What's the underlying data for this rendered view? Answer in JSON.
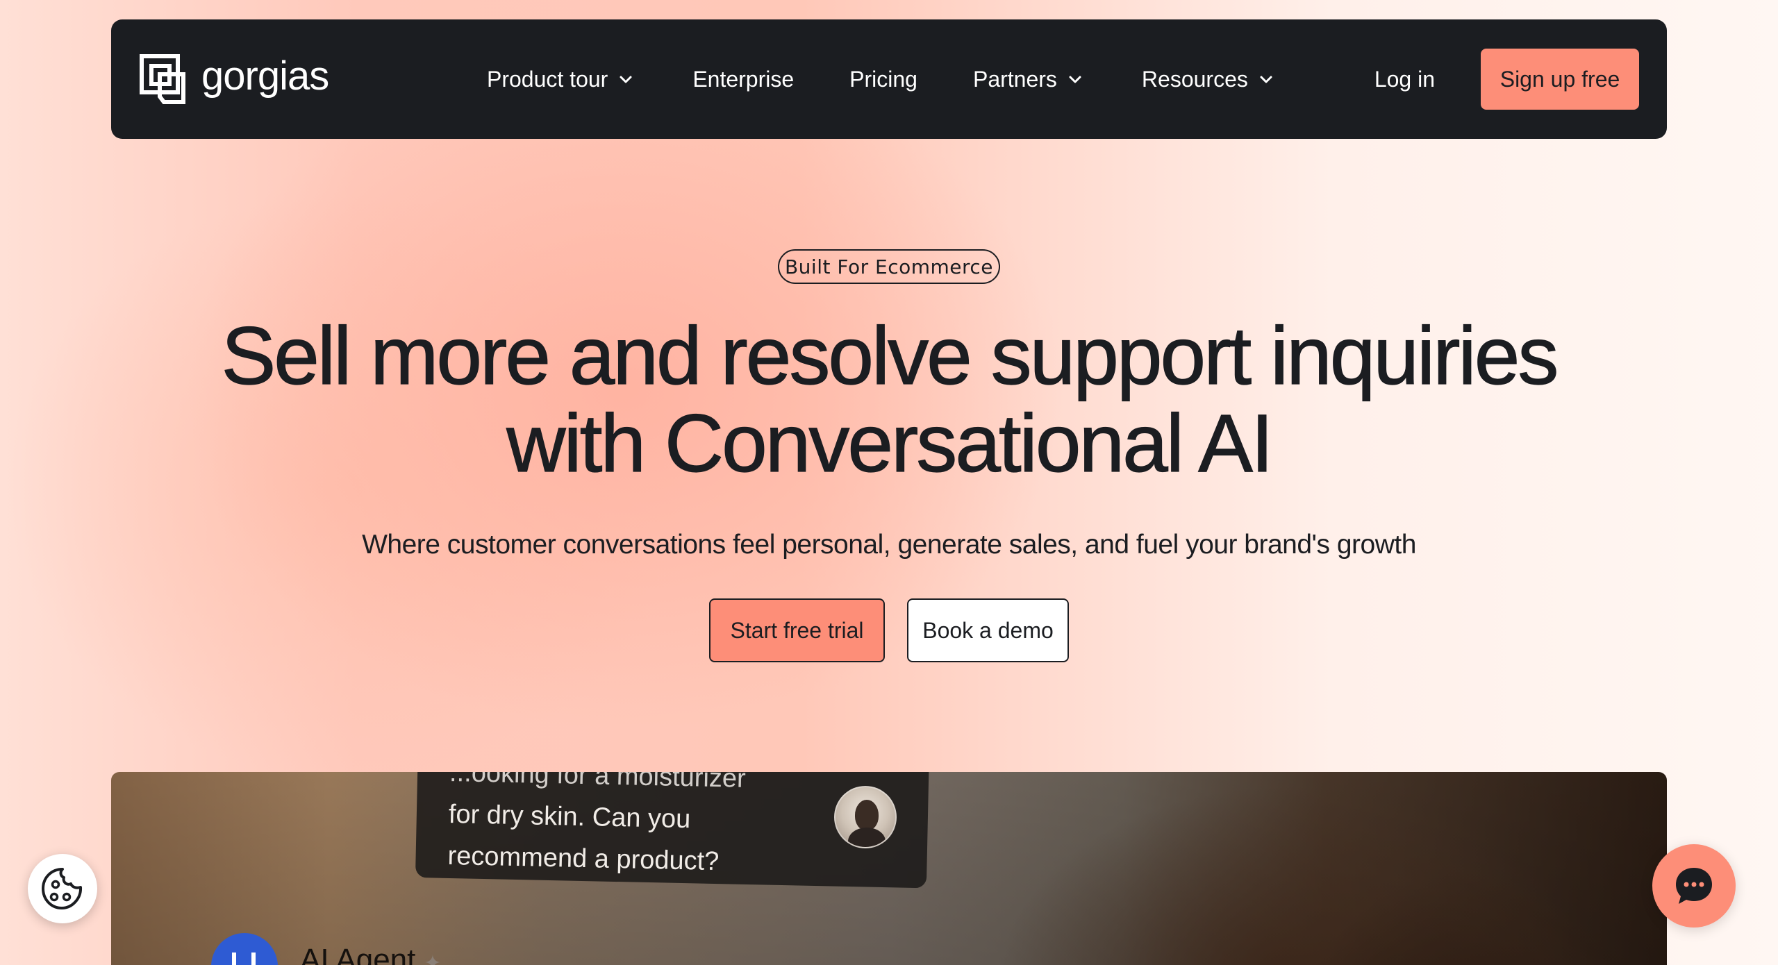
{
  "nav": {
    "logo_text": "gorgias",
    "items": [
      {
        "label": "Product tour",
        "has_dropdown": true
      },
      {
        "label": "Enterprise",
        "has_dropdown": false
      },
      {
        "label": "Pricing",
        "has_dropdown": false
      },
      {
        "label": "Partners",
        "has_dropdown": true
      },
      {
        "label": "Resources",
        "has_dropdown": true
      }
    ],
    "login_label": "Log in",
    "signup_label": "Sign up free"
  },
  "hero": {
    "badge": "Built For Ecommerce",
    "headline_line1": "Sell more and resolve support inquiries",
    "headline_line2": "with Conversational AI",
    "subheadline": "Where customer conversations feel personal, generate sales, and fuel your brand's growth",
    "primary_cta": "Start free trial",
    "secondary_cta": "Book a demo"
  },
  "media": {
    "message_line_partial": "...ooking for a moisturizer",
    "message_line2": "for dry skin. Can you",
    "message_line3": "recommend a product?",
    "agent_name": "AI Agent",
    "agent_sparkle": "✦"
  },
  "widgets": {
    "cookie_icon": "cookie-icon",
    "chat_icon": "chat-bubble-icon"
  },
  "colors": {
    "nav_background": "#1b1d21",
    "accent": "#fd8e78",
    "text": "#1b1d21",
    "agent_avatar": "#2e5bd3"
  }
}
